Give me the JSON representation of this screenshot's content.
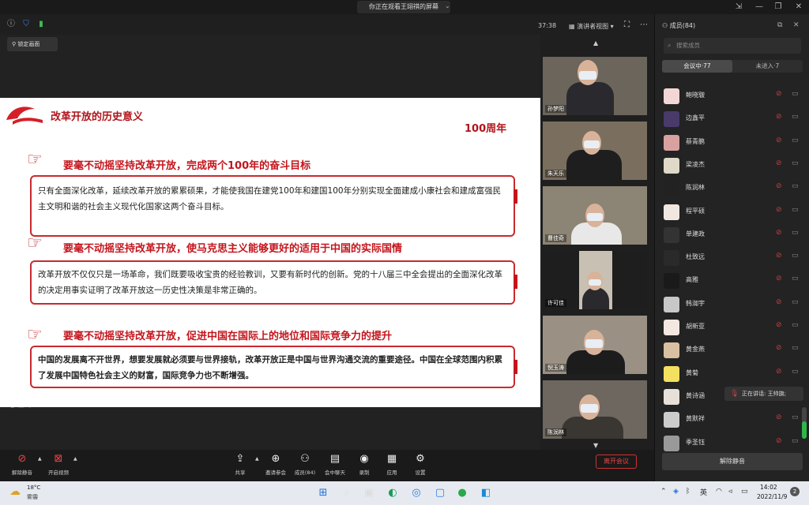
{
  "window": {
    "share_title": "你正在观看王翊祺的屏幕",
    "timer": "37:38",
    "view_mode": "演讲者视图",
    "lock_screen": "锁定画面"
  },
  "slide": {
    "header": "改革开放的历史意义",
    "centennial": "100周年",
    "sections": [
      {
        "heading": "要毫不动摇坚持改革开放，完成两个100年的奋斗目标",
        "body": "只有全面深化改革，延续改革开放的累累硕果，才能使我国在建党100年和建国100年分别实现全面建成小康社会和建成富强民主文明和谐的社会主义现代化国家这两个奋斗目标。"
      },
      {
        "heading": "要毫不动摇坚持改革开放，使马克思主义能够更好的适用于中国的实际国情",
        "body": "改革开放不仅仅只是一场革命，我们既要吸收宝贵的经验教训，又要有新时代的创新。党的十八届三中全会提出的全面深化改革的决定用事实证明了改革开放这一历史性决策是非常正确的。"
      },
      {
        "heading": "要毫不动摇坚持改革开放，促进中国在国际上的地位和国际竞争力的提升",
        "body": "中国的发展离不开世界，想要发展就必须要与世界接轨，改革开放正是中国与世界沟通交流的重要途径。中国在全球范围内积累了发展中国特色社会主义的财富，国际竞争力也不断增强。"
      }
    ]
  },
  "video_tiles": [
    {
      "name": "孙梦阳"
    },
    {
      "name": "朱天乐"
    },
    {
      "name": "曹佳奇"
    },
    {
      "name": "许可佳"
    },
    {
      "name": "倪玉涛"
    },
    {
      "name": "陈润林"
    }
  ],
  "toolbar": {
    "unmute": "解除静音",
    "start_video": "开启视频",
    "share": "共享",
    "invite": "邀请参会",
    "members": "成员(84)",
    "chat": "会中聊天",
    "record": "录制",
    "apps": "应用",
    "settings": "设置",
    "leave": "离开会议"
  },
  "panel": {
    "title": "成员(84)",
    "search_placeholder": "搜索成员",
    "tab_in_meeting": "会议中·77",
    "tab_not_joined": "未进入·7",
    "members": [
      "鲍晓皲",
      "边鑫平",
      "蔡青鹏",
      "梁凌杰",
      "陈润林",
      "程平硕",
      "单建政",
      "杜致远",
      "高雅",
      "韩洳宇",
      "胡新亚",
      "黄金燕",
      "黄菊",
      "黄诗涵",
      "黄默祥",
      "季圣钰"
    ],
    "speaking": "正在讲话: 王帅旗;",
    "unmute_all": "解除静音"
  },
  "taskbar": {
    "temperature": "18°C",
    "weather": "雾霾",
    "ime": "英",
    "time": "14:02",
    "date": "2022/11/9",
    "notification_count": "2"
  },
  "colors": {
    "accent_red": "#c4151c",
    "panel_bg": "#232323"
  }
}
